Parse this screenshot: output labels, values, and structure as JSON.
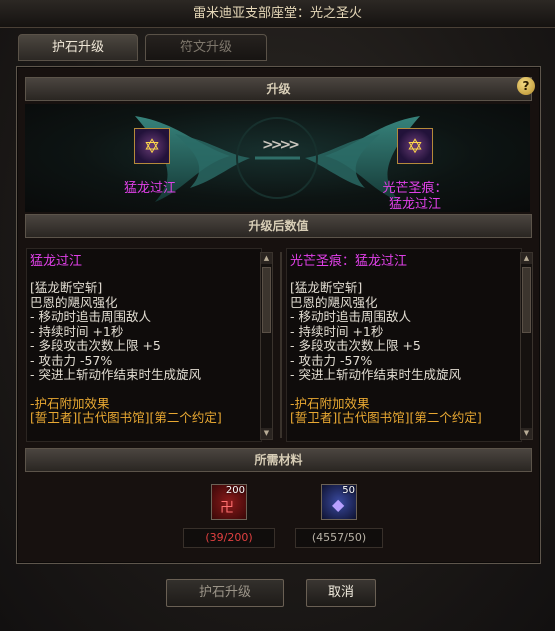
{
  "window": {
    "title": "雷米迪亚支部座堂：光之圣火"
  },
  "tabs": [
    {
      "label": "护石升级",
      "active": true
    },
    {
      "label": "符文升级",
      "active": false
    }
  ],
  "upgrade": {
    "header": "升级",
    "source_item": {
      "name": "猛龙过江",
      "icon": "star-of-david-charm-icon"
    },
    "target_item": {
      "name_line1": "光芒圣痕：",
      "name_line2": "猛龙过江",
      "icon": "star-of-david-charm-icon"
    },
    "arrows": ">>>>"
  },
  "stats": {
    "header": "升级后数值",
    "before": {
      "title": "猛龙过江",
      "lines": [
        "[猛龙断空斩]",
        "巴恩的飓风强化",
        "- 移动时追击周围敌人",
        "- 持续时间 +1秒",
        "- 多段攻击次数上限 +5",
        "- 攻击力 -57%",
        "- 突进上斩动作结束时生成旋风"
      ],
      "set_title": "-护石附加效果",
      "set_line": "[誓卫者][古代图书馆][第二个约定]"
    },
    "after": {
      "title": "光芒圣痕：猛龙过江",
      "lines": [
        "[猛龙断空斩]",
        "巴恩的飓风强化",
        "- 移动时追击周围敌人",
        "- 持续时间 +1秒",
        "- 多段攻击次数上限 +5",
        "- 攻击力 -57%",
        "- 突进上斩动作结束时生成旋风"
      ],
      "set_title": "-护石附加效果",
      "set_line": "[誓卫者][古代图书馆][第二个约定]"
    }
  },
  "materials": {
    "header": "所需材料",
    "items": [
      {
        "icon": "red-rune-material-icon",
        "stack": "200",
        "count": "(39/200)",
        "color": "#e04040"
      },
      {
        "icon": "purple-crystal-material-icon",
        "stack": "50",
        "count": "(4557/50)",
        "color": "#b8b2a6"
      }
    ]
  },
  "buttons": {
    "upgrade": "护石升级",
    "cancel": "取消"
  },
  "colors": {
    "item_name": "#e040e8",
    "set_effect": "#e8a832",
    "insufficient": "#e04040"
  }
}
